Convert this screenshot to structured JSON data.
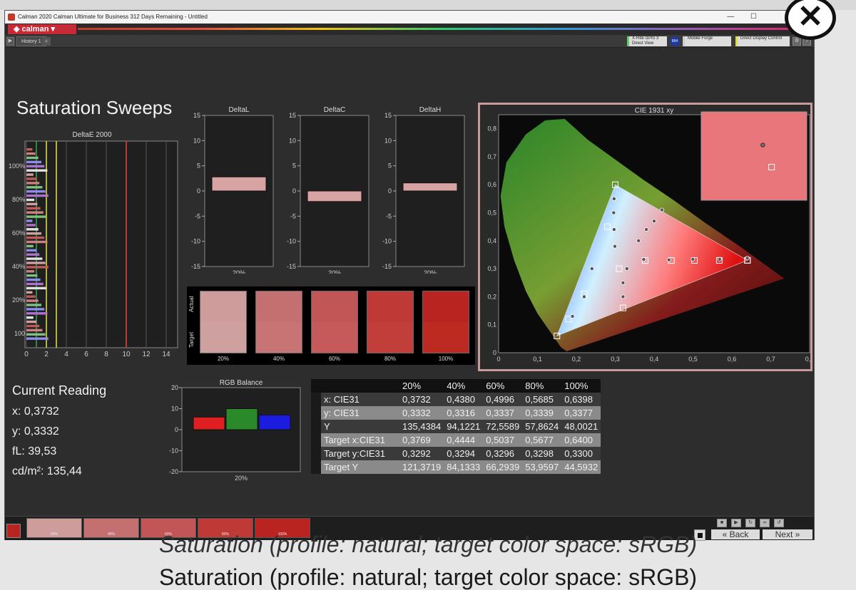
{
  "window": {
    "title": "Calman 2020 Calman Ultimate for Business 312 Days Remaining - Untitled",
    "logo": "calman",
    "history_tab": "History 1"
  },
  "devices": {
    "meter": "X-Rite i1Pro 3 Direct View",
    "badge": "894",
    "source": "Mobile Forge",
    "display": "Direct Display Control"
  },
  "page_title": "Saturation Sweeps",
  "chart_data": [
    {
      "type": "bar",
      "title": "DeltaE 2000",
      "orientation": "horizontal",
      "xticks": [
        "0",
        "2",
        "4",
        "6",
        "8",
        "10",
        "12",
        "14"
      ],
      "xlim": [
        0,
        15
      ],
      "ytick_labels": [
        "100%",
        "80%",
        "60%",
        "40%",
        "20%",
        "100"
      ],
      "reference_lines": [
        1,
        2,
        3,
        10
      ],
      "reference_colors": [
        "#3fa34d",
        "#e6e34d",
        "#e6e34d",
        "#e04b3a"
      ]
    },
    {
      "type": "bar",
      "title": "DeltaL",
      "categories": [
        "20%"
      ],
      "values": [
        2.8
      ],
      "ylim": [
        -15,
        15
      ],
      "yticks": [
        "15",
        "10",
        "5",
        "0",
        "-5",
        "-10",
        "-15"
      ]
    },
    {
      "type": "bar",
      "title": "DeltaC",
      "categories": [
        "20%"
      ],
      "values": [
        -2.1
      ],
      "ylim": [
        -15,
        15
      ],
      "yticks": [
        "15",
        "10",
        "5",
        "0",
        "-5",
        "-10",
        "-15"
      ]
    },
    {
      "type": "bar",
      "title": "DeltaH",
      "categories": [
        "20%"
      ],
      "values": [
        1.6
      ],
      "ylim": [
        -15,
        15
      ],
      "yticks": [
        "15",
        "10",
        "5",
        "0",
        "-5",
        "-10",
        "-15"
      ]
    },
    {
      "type": "bar",
      "title": "RGB Balance",
      "categories": [
        "20%"
      ],
      "series": [
        {
          "color": "#e02020",
          "values": [
            6
          ]
        },
        {
          "color": "#2a8a2a",
          "values": [
            10
          ]
        },
        {
          "color": "#1c1ce0",
          "values": [
            7
          ]
        }
      ],
      "ylim": [
        -20,
        20
      ],
      "yticks": [
        "20",
        "10",
        "0",
        "-10",
        "-20"
      ]
    },
    {
      "type": "scatter",
      "title": "CIE 1931 xy",
      "xlim": [
        0,
        0.8
      ],
      "ylim": [
        0,
        0.85
      ],
      "xticks": [
        "0",
        "0,1",
        "0,2",
        "0,3",
        "0,4",
        "0,5",
        "0,6",
        "0,7",
        "0,8"
      ],
      "yticks": [
        "0",
        "0,1",
        "0,2",
        "0,3",
        "0,4",
        "0,5",
        "0,6",
        "0,7",
        "0,8"
      ],
      "targets": [
        [
          0.64,
          0.33
        ],
        [
          0.3,
          0.6
        ],
        [
          0.15,
          0.06
        ],
        [
          0.3769,
          0.3292
        ],
        [
          0.4444,
          0.3294
        ],
        [
          0.5037,
          0.3296
        ],
        [
          0.5677,
          0.3298
        ],
        [
          0.64,
          0.33
        ],
        [
          0.28,
          0.45
        ],
        [
          0.22,
          0.21
        ],
        [
          0.18,
          0.12
        ],
        [
          0.32,
          0.16
        ],
        [
          0.31,
          0.3
        ]
      ],
      "measured": [
        [
          0.3732,
          0.3332
        ],
        [
          0.438,
          0.3316
        ],
        [
          0.4996,
          0.3337
        ],
        [
          0.5685,
          0.3339
        ],
        [
          0.6398,
          0.3377
        ],
        [
          0.297,
          0.55
        ],
        [
          0.296,
          0.5
        ],
        [
          0.297,
          0.44
        ],
        [
          0.299,
          0.38
        ],
        [
          0.36,
          0.4
        ],
        [
          0.38,
          0.44
        ],
        [
          0.4,
          0.47
        ],
        [
          0.42,
          0.51
        ],
        [
          0.24,
          0.3
        ],
        [
          0.22,
          0.2
        ],
        [
          0.19,
          0.13
        ],
        [
          0.33,
          0.3
        ],
        [
          0.32,
          0.25
        ],
        [
          0.32,
          0.2
        ]
      ],
      "inset_points": {
        "target": [
          0.68,
          0.31
        ],
        "measured": [
          0.67,
          0.33
        ]
      }
    }
  ],
  "swatches": {
    "actual_label": "Actual",
    "target_label": "Target",
    "items": [
      {
        "label": "20%",
        "actual": "#cf9c9c",
        "target": "#cfa0a0"
      },
      {
        "label": "40%",
        "actual": "#c47070",
        "target": "#c87474"
      },
      {
        "label": "60%",
        "actual": "#c25656",
        "target": "#c65a5a"
      },
      {
        "label": "80%",
        "actual": "#bf3a36",
        "target": "#c23e3a"
      },
      {
        "label": "100%",
        "actual": "#ba2420",
        "target": "#bc2a22"
      }
    ]
  },
  "current_reading": {
    "heading": "Current Reading",
    "x": "x: 0,3732",
    "y": "y: 0,3332",
    "fL": "fL: 39,53",
    "cdm2": "cd/m²: 135,44"
  },
  "table": {
    "columns": [
      "20%",
      "40%",
      "60%",
      "80%",
      "100%"
    ],
    "rows": [
      {
        "label": "x: CIE31",
        "values": [
          "0,3732",
          "0,4380",
          "0,4996",
          "0,5685",
          "0,6398"
        ]
      },
      {
        "label": "y: CIE31",
        "values": [
          "0,3332",
          "0,3316",
          "0,3337",
          "0,3339",
          "0,3377"
        ]
      },
      {
        "label": "Y",
        "values": [
          "135,4384",
          "94,1221",
          "72,5589",
          "57,8624",
          "48,0021"
        ]
      },
      {
        "label": "Target x:CIE31",
        "values": [
          "0,3769",
          "0,4444",
          "0,5037",
          "0,5677",
          "0,6400"
        ]
      },
      {
        "label": "Target y:CIE31",
        "values": [
          "0,3292",
          "0,3294",
          "0,3296",
          "0,3298",
          "0,3300"
        ]
      },
      {
        "label": "Target Y",
        "values": [
          "121,3719",
          "84,1333",
          "66,2939",
          "53,9597",
          "44,5932"
        ]
      }
    ]
  },
  "bottom": {
    "swatches": [
      {
        "label": "20%",
        "color": "#cf9c9c"
      },
      {
        "label": "40%",
        "color": "#c47070"
      },
      {
        "label": "60%",
        "color": "#c25656"
      },
      {
        "label": "80%",
        "color": "#bf3a36"
      },
      {
        "label": "100%",
        "color": "#ba2420"
      }
    ],
    "back": "Back",
    "next": "Next"
  },
  "caption": "Saturation (profile: natural; target color space: sRGB)"
}
